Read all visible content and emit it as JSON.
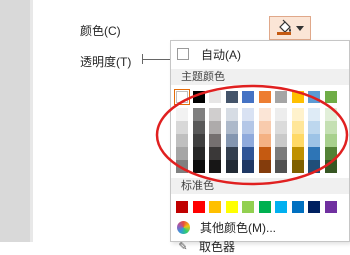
{
  "properties": {
    "color_label": "颜色(C)",
    "transparency_label": "透明度(T)"
  },
  "color_button": {
    "icon": "paint-bucket-icon",
    "current_color": "#c55a11",
    "fill_color": "#fbe5d6"
  },
  "dropdown": {
    "auto_label": "自动(A)",
    "theme_header": "主题颜色",
    "standard_header": "标准色",
    "more_colors_label": "其他颜色(M)...",
    "eyedropper_label": "取色器"
  },
  "theme_colors": {
    "base": [
      "#ffffff",
      "#000000",
      "#e7e6e6",
      "#44546a",
      "#4472c4",
      "#ed7d31",
      "#a5a5a5",
      "#ffc000",
      "#5b9bd5",
      "#70ad47"
    ],
    "shades": [
      [
        "#f2f2f2",
        "#7f7f7f",
        "#d0cece",
        "#d6dce4",
        "#d9e2f3",
        "#fbe5d6",
        "#ededed",
        "#fff2cc",
        "#deebf6",
        "#e2efd9"
      ],
      [
        "#d8d8d8",
        "#595959",
        "#aeabab",
        "#adb9ca",
        "#b4c7e7",
        "#f8cbad",
        "#dbdbdb",
        "#ffe699",
        "#bdd7ee",
        "#c5e0b3"
      ],
      [
        "#bfbfbf",
        "#3f3f3f",
        "#757070",
        "#8496b0",
        "#8faadc",
        "#f4b183",
        "#c9c9c9",
        "#ffd966",
        "#9dc3e6",
        "#a8d08d"
      ],
      [
        "#a5a5a5",
        "#262626",
        "#3a3838",
        "#333f4f",
        "#2f5597",
        "#c55a11",
        "#7b7b7b",
        "#bf9000",
        "#2e75b6",
        "#538135"
      ],
      [
        "#7f7f7f",
        "#0d0d0d",
        "#171616",
        "#222a35",
        "#1f3864",
        "#843c0c",
        "#525252",
        "#7f6000",
        "#1f4e79",
        "#375623"
      ]
    ]
  },
  "standard_colors": [
    "#c00000",
    "#ff0000",
    "#ffc000",
    "#ffff00",
    "#92d050",
    "#00b050",
    "#00b0f0",
    "#0070c0",
    "#002060",
    "#7030a0"
  ],
  "annotation_color": "#e02020"
}
